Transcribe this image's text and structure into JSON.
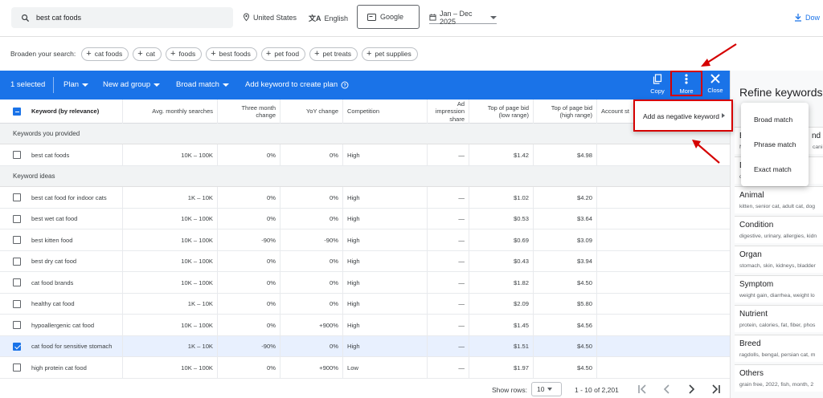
{
  "search": {
    "query": "best cat foods"
  },
  "topbar": {
    "location": "United States",
    "language": "English",
    "network": "Google",
    "date_range": "Jan – Dec 2025",
    "download": "Dow"
  },
  "broaden": {
    "label": "Broaden your search:",
    "chips": [
      "cat foods",
      "cat",
      "foods",
      "best foods",
      "pet food",
      "pet treats",
      "pet supplies"
    ]
  },
  "actionbar": {
    "selected": "1 selected",
    "plan": "Plan",
    "new_ad_group": "New ad group",
    "broad_match": "Broad match",
    "add_keyword": "Add keyword to create plan",
    "copy": "Copy",
    "more": "More",
    "close": "Close"
  },
  "table": {
    "headers": [
      "Keyword (by relevance)",
      "Avg. monthly searches",
      "Three month change",
      "YoY change",
      "Competition",
      "Ad impression share",
      "Top of page bid (low range)",
      "Top of page bid (high range)",
      "Account st"
    ],
    "section_provided": "Keywords you provided",
    "section_ideas": "Keyword ideas",
    "provided_rows": [
      {
        "keyword": "best cat foods",
        "searches": "10K – 100K",
        "three_month": "0%",
        "yoy": "0%",
        "competition": "High",
        "impression": "—",
        "bid_low": "$1.42",
        "bid_high": "$4.98",
        "checked": false
      }
    ],
    "idea_rows": [
      {
        "keyword": "best cat food for indoor cats",
        "searches": "1K – 10K",
        "three_month": "0%",
        "yoy": "0%",
        "competition": "High",
        "impression": "—",
        "bid_low": "$1.02",
        "bid_high": "$4.20",
        "checked": false
      },
      {
        "keyword": "best wet cat food",
        "searches": "10K – 100K",
        "three_month": "0%",
        "yoy": "0%",
        "competition": "High",
        "impression": "—",
        "bid_low": "$0.53",
        "bid_high": "$3.64",
        "checked": false
      },
      {
        "keyword": "best kitten food",
        "searches": "10K – 100K",
        "three_month": "-90%",
        "yoy": "-90%",
        "competition": "High",
        "impression": "—",
        "bid_low": "$0.69",
        "bid_high": "$3.09",
        "checked": false
      },
      {
        "keyword": "best dry cat food",
        "searches": "10K – 100K",
        "three_month": "0%",
        "yoy": "0%",
        "competition": "High",
        "impression": "—",
        "bid_low": "$0.43",
        "bid_high": "$3.94",
        "checked": false
      },
      {
        "keyword": "cat food brands",
        "searches": "10K – 100K",
        "three_month": "0%",
        "yoy": "0%",
        "competition": "High",
        "impression": "—",
        "bid_low": "$1.82",
        "bid_high": "$4.50",
        "checked": false
      },
      {
        "keyword": "healthy cat food",
        "searches": "1K – 10K",
        "three_month": "0%",
        "yoy": "0%",
        "competition": "High",
        "impression": "—",
        "bid_low": "$2.09",
        "bid_high": "$5.80",
        "checked": false
      },
      {
        "keyword": "hypoallergenic cat food",
        "searches": "10K – 100K",
        "three_month": "0%",
        "yoy": "+900%",
        "competition": "High",
        "impression": "—",
        "bid_low": "$1.45",
        "bid_high": "$4.56",
        "checked": false
      },
      {
        "keyword": "cat food for sensitive stomach",
        "searches": "1K – 10K",
        "three_month": "-90%",
        "yoy": "0%",
        "competition": "High",
        "impression": "—",
        "bid_low": "$1.51",
        "bid_high": "$4.50",
        "checked": true
      },
      {
        "keyword": "high protein cat food",
        "searches": "10K – 100K",
        "three_month": "0%",
        "yoy": "+900%",
        "competition": "Low",
        "impression": "—",
        "bid_low": "$1.97",
        "bid_high": "$4.50",
        "checked": false
      }
    ]
  },
  "footer": {
    "show_rows_label": "Show rows:",
    "rows_value": "10",
    "range": "1 - 10 of 2,201"
  },
  "menu_more": {
    "item": "Add as negative keyword"
  },
  "menu_match": {
    "items": [
      "Broad match",
      "Phrase match",
      "Exact match"
    ]
  },
  "refine": {
    "title": "Refine keywords",
    "partial_items": [
      {
        "title": "B",
        "title_end": "nd",
        "subtitle": "N",
        "subtitle_end": "canin"
      },
      {
        "title": "D",
        "subtitle": "c"
      }
    ],
    "groups": [
      {
        "title": "Animal",
        "subtitle": "kitten, senior cat, adult cat, dog"
      },
      {
        "title": "Condition",
        "subtitle": "digestive, urinary, allergies, kidn"
      },
      {
        "title": "Organ",
        "subtitle": "stomach, skin, kidneys, bladder"
      },
      {
        "title": "Symptom",
        "subtitle": "weight gain, diarrhea, weight lo"
      },
      {
        "title": "Nutrient",
        "subtitle": "protein, calories, fat, fiber, phos"
      },
      {
        "title": "Breed",
        "subtitle": "ragdolls, bengal, persian cat, m"
      },
      {
        "title": "Others",
        "subtitle": "grain free, 2022, fish, month, 2"
      }
    ]
  },
  "colors": {
    "primary": "#1a73e8",
    "annotation_red": "#d50000",
    "selected_row": "#e8f0fe"
  }
}
